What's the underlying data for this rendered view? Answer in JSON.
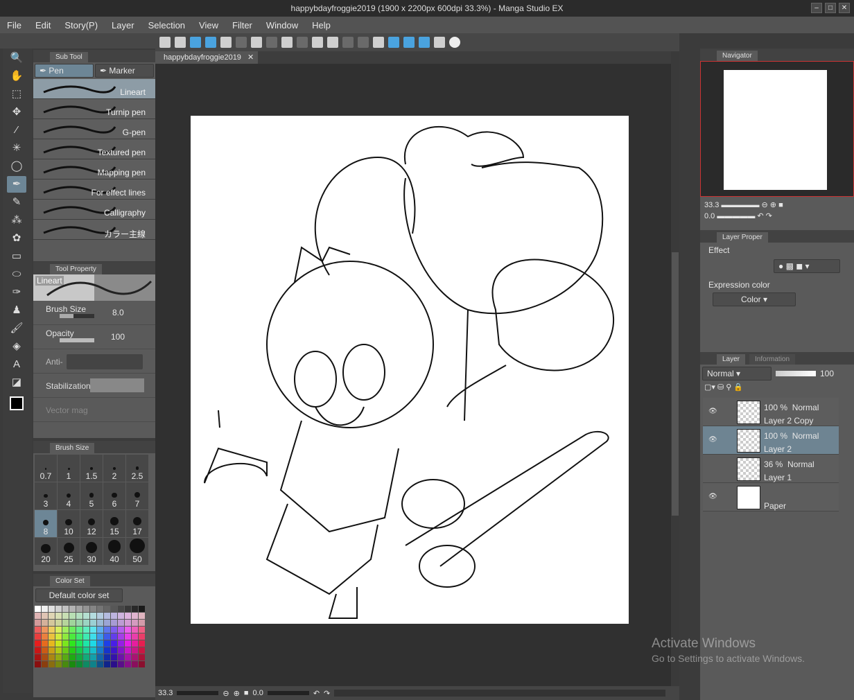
{
  "title": "happybdayfroggie2019 (1900 x 2200px 600dpi 33.3%)  - Manga Studio EX",
  "menu": [
    "File",
    "Edit",
    "Story(P)",
    "Layer",
    "Selection",
    "View",
    "Filter",
    "Window",
    "Help"
  ],
  "document_tab": "happybdayfroggie2019",
  "sub_tool": {
    "tab": "Sub Tool",
    "groups": [
      "Pen",
      "Marker"
    ],
    "brushes": [
      "Lineart",
      "Turnip pen",
      "G-pen",
      "Textured pen",
      "Mapping pen",
      "For effect lines",
      "Calligraphy",
      "カラー主線"
    ]
  },
  "tool_property": {
    "tab": "Tool Property",
    "preview_label": "Lineart",
    "brush_size_label": "Brush Size",
    "brush_size": "8.0",
    "opacity_label": "Opacity",
    "opacity": "100",
    "anti_label": "Anti-",
    "stabilization_label": "Stabilization",
    "vector_label": "Vector mag"
  },
  "brush_size_panel": {
    "tab": "Brush Size",
    "sizes": [
      "0.7",
      "1",
      "1.5",
      "2",
      "2.5",
      "3",
      "4",
      "5",
      "6",
      "7",
      "8",
      "10",
      "12",
      "15",
      "17",
      "20",
      "25",
      "30",
      "40",
      "50"
    ],
    "selected": "8"
  },
  "color_set": {
    "tab": "Color Set",
    "selected": "Default color set"
  },
  "navigator": {
    "tab": "Navigator",
    "zoom": "33.3",
    "rotation": "0.0"
  },
  "layer_property": {
    "tab": "Layer Proper",
    "effect_label": "Effect",
    "expression_label": "Expression color",
    "expression_value": "Color"
  },
  "layer_panel": {
    "tab": "Layer",
    "tab2": "Information",
    "blend": "Normal",
    "opacity": "100",
    "layers": [
      {
        "name": "Layer 2 Copy",
        "opacity": "100 %",
        "blend": "Normal"
      },
      {
        "name": "Layer 2",
        "opacity": "100 %",
        "blend": "Normal"
      },
      {
        "name": "Layer 1",
        "opacity": "36 %",
        "blend": "Normal"
      },
      {
        "name": "Paper",
        "opacity": "",
        "blend": ""
      }
    ]
  },
  "status": {
    "zoom": "33.3",
    "rotation": "0.0"
  },
  "watermark": {
    "line1": "Activate Windows",
    "line2": "Go to Settings to activate Windows."
  },
  "colors": {
    "accent": "#6d8696",
    "panel": "#5a5a5a"
  }
}
